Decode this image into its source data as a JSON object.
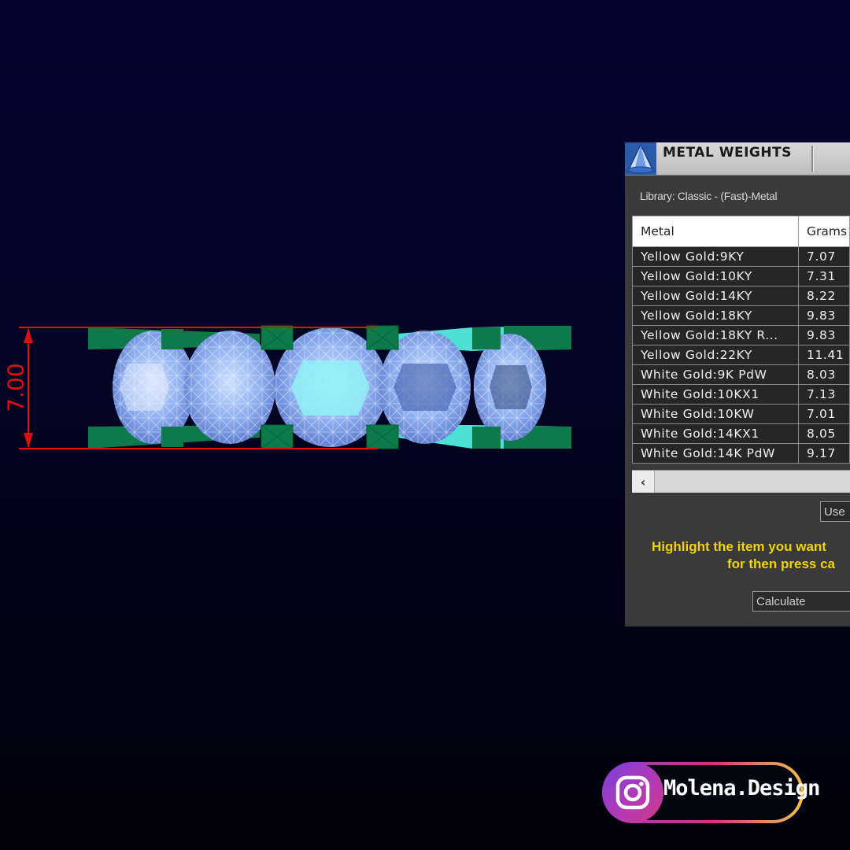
{
  "dimension": {
    "value": "7.00"
  },
  "panel": {
    "title": "METAL WEIGHTS",
    "library": "Library: Classic - (Fast)-Metal",
    "columns": [
      "Metal",
      "Grams"
    ],
    "rows": [
      [
        "Yellow Gold:9KY",
        "7.07"
      ],
      [
        "Yellow Gold:10KY",
        "7.31"
      ],
      [
        "Yellow Gold:14KY",
        "8.22"
      ],
      [
        "Yellow Gold:18KY",
        "9.83"
      ],
      [
        "Yellow Gold:18KY R...",
        "9.83"
      ],
      [
        "Yellow Gold:22KY",
        "11.41"
      ],
      [
        "White Gold:9K PdW",
        "8.03"
      ],
      [
        "White Gold:10KX1",
        "7.13"
      ],
      [
        "White Gold:10KW",
        "7.01"
      ],
      [
        "White Gold:14KX1",
        "8.05"
      ],
      [
        "White Gold:14K PdW",
        "9.17"
      ]
    ],
    "use_button": "Use",
    "hint_line1": "Highlight the item you want",
    "hint_line2": "for then press ca",
    "calculate_select": "Calculate"
  },
  "badge": {
    "text": "Molena.Design",
    "icon": "instagram-icon"
  },
  "colors": {
    "dimension_red": "#e01010",
    "prong_green": "#0e7a4a",
    "shank_cyan": "#4de0d6",
    "stone_blue": "#7fa6e8",
    "hint_yellow": "#f2d200"
  }
}
